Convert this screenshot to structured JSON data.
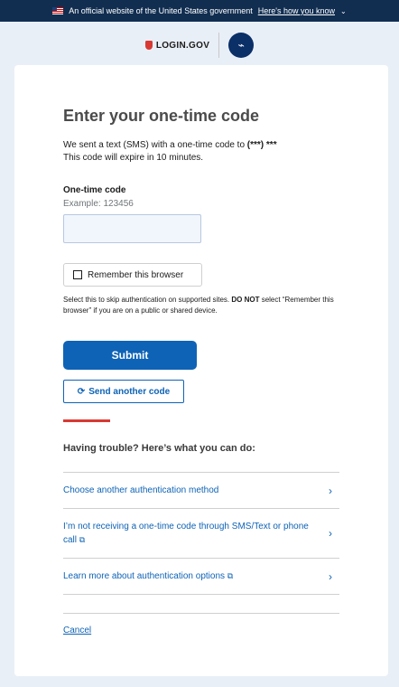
{
  "gov_banner": {
    "text": "An official website of the United States government",
    "link": "Here's how you know"
  },
  "header": {
    "brand": "LOGIN.GOV"
  },
  "page": {
    "title": "Enter your one-time code",
    "desc_line1": "We sent a text (SMS) with a one-time code to",
    "desc_number": "(***) ***",
    "desc_line2": "This code will expire in 10 minutes.",
    "otp_label": "One-time code",
    "otp_hint": "Example: 123456",
    "remember_label": "Remember this browser",
    "remember_help_1": "Select this to skip authentication on supported sites.",
    "remember_help_bold": "DO NOT",
    "remember_help_2": "select “Remember this browser” if you are on a public or shared device.",
    "submit_label": "Submit",
    "send_another_label": "Send another code",
    "trouble_title": "Having trouble? Here’s what you can do:",
    "options": [
      "Choose another authentication method",
      "I’m not receiving a one-time code through SMS/Text or phone call",
      "Learn more about authentication options"
    ],
    "cancel": "Cancel"
  }
}
